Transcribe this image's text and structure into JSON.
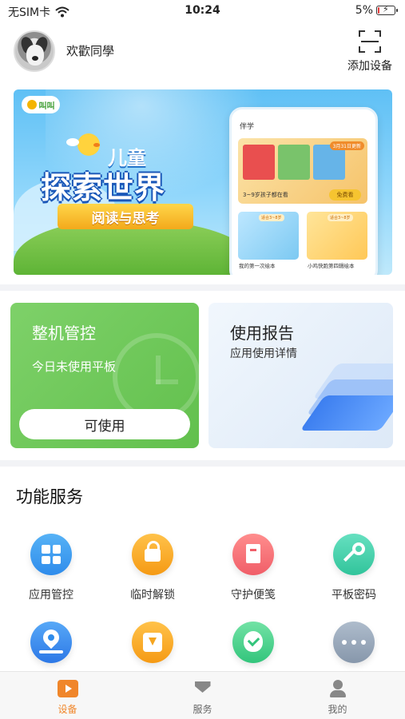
{
  "status_bar": {
    "carrier": "无SIM卡",
    "time": "10:24",
    "battery_text": "5%",
    "battery_level": 0.05,
    "icons": [
      "wifi-icon",
      "battery-charging-icon"
    ]
  },
  "header": {
    "greeting": "欢歡同學",
    "add_device_label": "添加设备",
    "icons": [
      "avatar",
      "scan-icon"
    ]
  },
  "banner": {
    "logo_text": "叫叫",
    "kid_text": "儿童",
    "headline": "探索世界",
    "ribbon_text": "阅读与思考",
    "phone": {
      "title": "伴学",
      "featured_tag": "3月31日更新",
      "featured_caption": "3~9岁孩子都在看",
      "featured_button": "免费看",
      "mini_tag": "适合3~8岁",
      "mini_captions": [
        "我的第一次绘本",
        "小鸡快跑第四辑绘本"
      ]
    }
  },
  "control_card": {
    "title": "整机管控",
    "subtitle": "今日未使用平板",
    "button_label": "可使用",
    "accent_color": "#6cc758"
  },
  "report_card": {
    "title": "使用报告",
    "subtitle": "应用使用详情",
    "accent_color": "#3d7ff0"
  },
  "services": {
    "title": "功能服务",
    "items": [
      {
        "label": "应用管控",
        "icon": "app-grid-icon"
      },
      {
        "label": "临时解锁",
        "icon": "unlock-icon"
      },
      {
        "label": "守护便笺",
        "icon": "note-book-icon"
      },
      {
        "label": "平板密码",
        "icon": "key-icon"
      },
      {
        "label": "",
        "icon": "location-pin-icon"
      },
      {
        "label": "",
        "icon": "download-icon"
      },
      {
        "label": "",
        "icon": "shield-check-icon"
      },
      {
        "label": "",
        "icon": "more-dots-icon"
      }
    ]
  },
  "tabbar": {
    "tabs": [
      {
        "label": "设备",
        "icon": "device-play-icon",
        "active": true
      },
      {
        "label": "服务",
        "icon": "diamond-service-icon",
        "active": false
      },
      {
        "label": "我的",
        "icon": "profile-icon",
        "active": false
      }
    ],
    "active_color": "#f0862a"
  }
}
